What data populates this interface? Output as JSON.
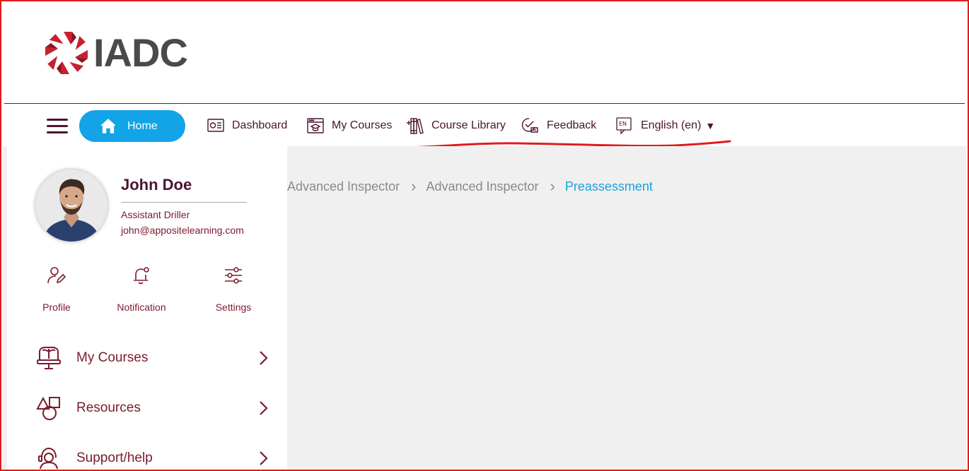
{
  "logo": {
    "text": "IADC"
  },
  "nav": {
    "home": "Home",
    "items": [
      {
        "label": "Dashboard",
        "icon": "dashboard-icon"
      },
      {
        "label": "My Courses",
        "icon": "courses-icon"
      },
      {
        "label": "Course Library",
        "icon": "library-icon"
      },
      {
        "label": "Feedback",
        "icon": "feedback-icon"
      },
      {
        "label": "English (en)",
        "icon": "language-icon"
      }
    ]
  },
  "breadcrumb": {
    "items": [
      "Advanced Inspector",
      "Advanced Inspector",
      "Preassessment"
    ]
  },
  "user": {
    "name": "John Doe",
    "role": "Assistant Driller",
    "email": "john@appositelearning.com"
  },
  "quick_actions": [
    {
      "label": "Profile",
      "icon": "profile-edit-icon"
    },
    {
      "label": "Notification",
      "icon": "bell-icon"
    },
    {
      "label": "Settings",
      "icon": "sliders-icon"
    }
  ],
  "menu": [
    {
      "label": "My Courses",
      "icon": "monitor-book-icon"
    },
    {
      "label": "Resources",
      "icon": "shapes-icon"
    },
    {
      "label": "Support/help",
      "icon": "support-icon"
    }
  ],
  "colors": {
    "accent_blue": "#12a4e6",
    "maroon": "#7a1b2e",
    "dark_maroon": "#4a1530",
    "annotation_red": "#e21b1b",
    "panel_gray": "#f0f0f0"
  }
}
